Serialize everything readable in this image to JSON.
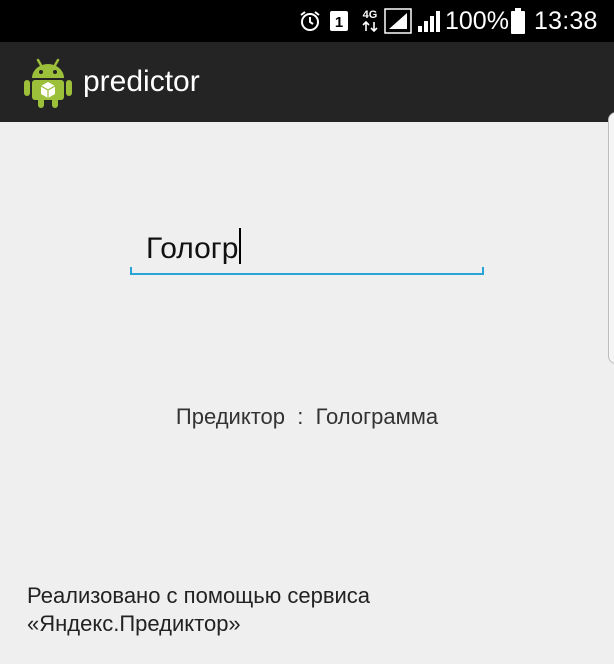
{
  "status_bar": {
    "icons": [
      "alarm-icon",
      "sim-1-icon",
      "4g-data-icon",
      "signal-sim1-icon",
      "signal-sim2-icon",
      "battery-icon"
    ],
    "network_type": "4G",
    "sim_slot": "1",
    "battery_percent": "100%",
    "time": "13:38"
  },
  "action_bar": {
    "app_icon": "android-robot-icon",
    "title": "predictor"
  },
  "input": {
    "value": "Гологр"
  },
  "prediction": {
    "text": "Предиктор  :  Голограмма"
  },
  "footer": {
    "line1": "Реализовано с помощью сервиса",
    "line2": "«Яндекс.Предиктор»"
  },
  "colors": {
    "accent": "#2aa3d8",
    "action_bar": "#242424",
    "status_bar": "#000000",
    "background": "#efefef",
    "android_green": "#9dc03b"
  }
}
